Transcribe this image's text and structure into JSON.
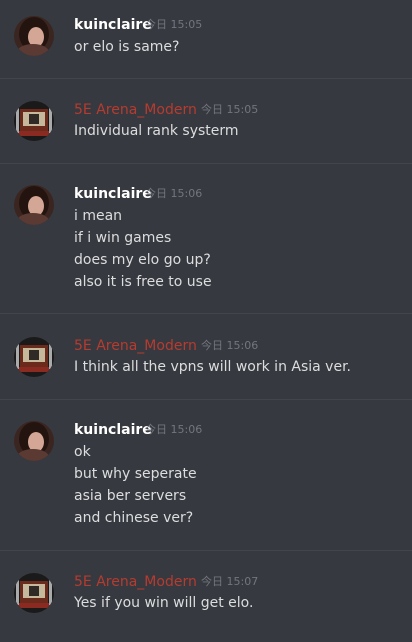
{
  "messages": [
    {
      "author": "kuinclaire",
      "timestamp": "今日 15:05",
      "lines": [
        "or elo is same?"
      ]
    },
    {
      "author": "5E Arena_Modern",
      "timestamp": "今日 15:05",
      "lines": [
        "Individual rank systerm"
      ]
    },
    {
      "author": "kuinclaire",
      "timestamp": "今日 15:06",
      "lines": [
        "i mean",
        "if i win games",
        "does my elo go up?",
        "also it is free to use"
      ]
    },
    {
      "author": "5E Arena_Modern",
      "timestamp": "今日 15:06",
      "lines": [
        "I think all the vpns will work in Asia ver."
      ]
    },
    {
      "author": "kuinclaire",
      "timestamp": "今日 15:06",
      "lines": [
        "ok",
        "but why seperate",
        "asia ber servers",
        "and chinese ver?"
      ]
    },
    {
      "author": "5E Arena_Modern",
      "timestamp": "今日 15:07",
      "lines": [
        "Yes if you win will get elo."
      ]
    }
  ],
  "colors": {
    "background": "#36393f",
    "username_user": "#ffffff",
    "username_bot": "#b73b2f",
    "timestamp": "#72767d",
    "text": "#dcddde"
  }
}
